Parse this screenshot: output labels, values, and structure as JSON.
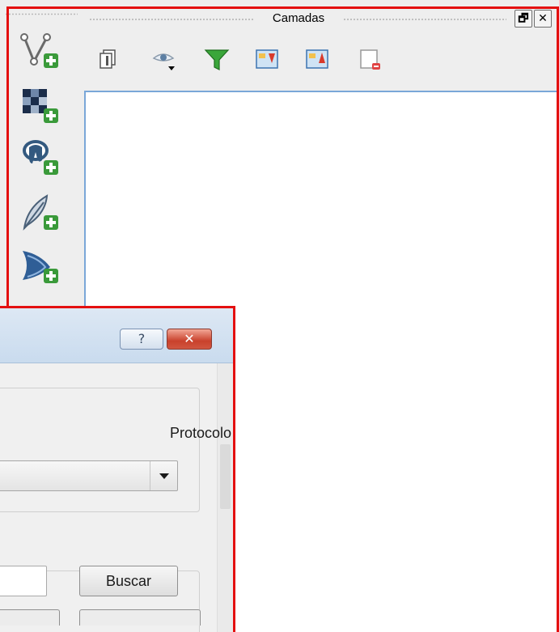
{
  "dock": {
    "title": "Camadas",
    "float_glyph": "🗗",
    "close_glyph": "✕",
    "toolbar": [
      {
        "icon": "add-group-icon"
      },
      {
        "icon": "manage-visibility-icon"
      },
      {
        "icon": "filter-legend-icon"
      },
      {
        "icon": "expand-all-icon"
      },
      {
        "icon": "collapse-all-icon"
      },
      {
        "icon": "remove-layer-icon"
      }
    ]
  },
  "left_toolbar": [
    {
      "icon": "add-vector-layer-icon"
    },
    {
      "icon": "add-raster-layer-icon"
    },
    {
      "icon": "add-postgis-layer-icon"
    },
    {
      "icon": "add-spatialite-layer-icon"
    },
    {
      "icon": "add-mssql-layer-icon"
    }
  ],
  "dialog": {
    "help_glyph": "?",
    "close_glyph": "✕",
    "protocol_label": "Protocolo",
    "protocol_value": "",
    "search_value": "",
    "search_button": "Buscar"
  },
  "colors": {
    "annotation_red": "#e41010",
    "list_border": "#7aa7d8",
    "plus_green": "#3a9a3a"
  }
}
